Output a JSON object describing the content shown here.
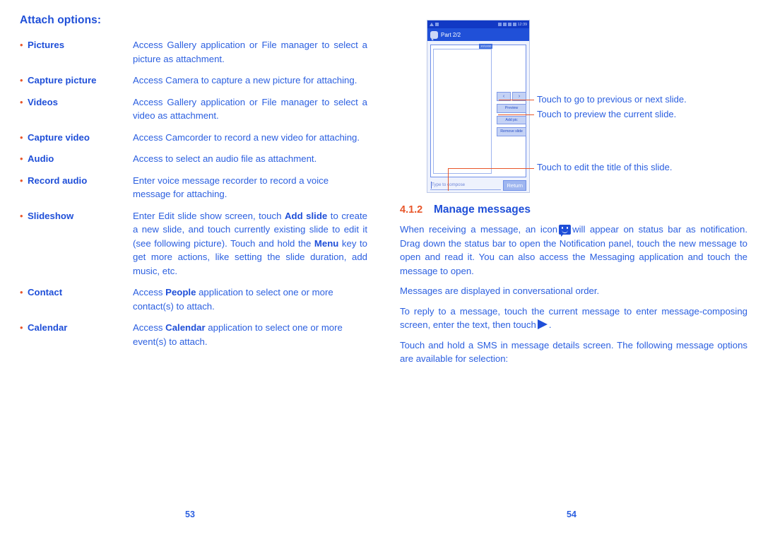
{
  "left_page": {
    "heading": "Attach options:",
    "options": [
      {
        "bullet": "•",
        "term": "Pictures",
        "desc_pre": "Access Gallery application or File manager to select a picture as attachment.",
        "desc_parts": null
      },
      {
        "bullet": "•",
        "term": "Capture picture",
        "desc_pre": "Access Camera to capture a new picture for attaching.",
        "desc_parts": null
      },
      {
        "bullet": "•",
        "term": "Videos",
        "desc_pre": "Access Gallery application or File manager to select a video as attachment.",
        "desc_parts": null
      },
      {
        "bullet": "•",
        "term": "Capture video",
        "desc_pre": "Access Camcorder to record a new video for attaching.",
        "desc_parts": null
      },
      {
        "bullet": "•",
        "term": "Audio",
        "desc_pre": "Access to select an audio file as attachment.",
        "desc_parts": null
      },
      {
        "bullet": "•",
        "term": "Record audio",
        "desc_pre": "Enter voice message recorder to record a voice message for attaching.",
        "desc_parts": null
      },
      {
        "bullet": "•",
        "term": "Slideshow",
        "desc_pre": "Enter Edit slide show screen, touch ",
        "bold1": "Add slide",
        "desc_mid": " to create a new slide, and touch currently existing slide to edit it (see following picture). Touch and hold the ",
        "bold2": "Menu",
        "desc_post": " key to get more actions, like setting the slide duration, add music, etc."
      },
      {
        "bullet": "•",
        "term": "Contact",
        "desc_pre": "Access ",
        "bold1": "People",
        "desc_post": " application to select one or more contact(s) to attach."
      },
      {
        "bullet": "•",
        "term": "Calendar",
        "desc_pre": "Access ",
        "bold1": "Calendar",
        "desc_post": " application to select one or more event(s) to attach."
      }
    ],
    "page_number": "53"
  },
  "right_page": {
    "figure": {
      "phone": {
        "status_bar": {
          "time": "12:39"
        },
        "app_bar": {
          "title": "Part 2/2",
          "icon": "message-bubble-icon"
        },
        "character_counter": "20/1000",
        "nav_prev_label": "‹",
        "nav_next_label": "›",
        "side_buttons": [
          "Preview",
          "Add pic",
          "Remove slide"
        ],
        "compose_placeholder": "Type to compose",
        "return_button": "Return"
      },
      "callouts": [
        "Touch to go to previous or next slide.",
        "Touch to preview the current slide.",
        "Touch to edit the title of this slide."
      ]
    },
    "section": {
      "number": "4.1.2",
      "title": "Manage messages"
    },
    "paragraphs": {
      "p1_a": "When receiving a message, an icon",
      "p1_b": "will appear on status bar as notification. Drag down the status bar to open the Notification panel, touch the new message to open and read it. You can also access the Messaging application and touch the message to open.",
      "p2": "Messages are displayed in conversational order.",
      "p3_a": "To reply to a message, touch the current message to enter message-composing screen, enter the text, then touch",
      "p3_b": ".",
      "p4": "Touch and hold a SMS in message details screen. The following message options are available for selection:"
    },
    "page_number": "54"
  },
  "colors": {
    "body_blue": "#2b5fe0",
    "heading_blue": "#1f4fd8",
    "accent_orange": "#e8562a",
    "phone_chrome": "#1a4fd4"
  }
}
